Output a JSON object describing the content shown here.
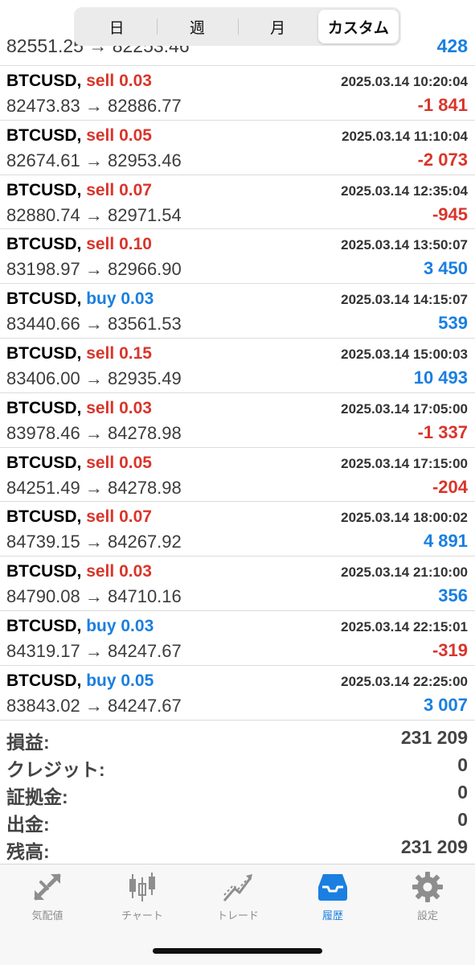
{
  "period_tabs": [
    "日",
    "週",
    "月",
    "カスタム"
  ],
  "partial_row": {
    "prices": "82551.25 → 82253.46",
    "profit": "428"
  },
  "trades": [
    {
      "symbol": "BTCUSD,",
      "type": "sell",
      "volume": "0.03",
      "time": "2025.03.14 10:20:04",
      "open": "82473.83",
      "close": "82886.77",
      "profit": "-1 841"
    },
    {
      "symbol": "BTCUSD,",
      "type": "sell",
      "volume": "0.05",
      "time": "2025.03.14 11:10:04",
      "open": "82674.61",
      "close": "82953.46",
      "profit": "-2 073"
    },
    {
      "symbol": "BTCUSD,",
      "type": "sell",
      "volume": "0.07",
      "time": "2025.03.14 12:35:04",
      "open": "82880.74",
      "close": "82971.54",
      "profit": "-945"
    },
    {
      "symbol": "BTCUSD,",
      "type": "sell",
      "volume": "0.10",
      "time": "2025.03.14 13:50:07",
      "open": "83198.97",
      "close": "82966.90",
      "profit": "3 450"
    },
    {
      "symbol": "BTCUSD,",
      "type": "buy",
      "volume": "0.03",
      "time": "2025.03.14 14:15:07",
      "open": "83440.66",
      "close": "83561.53",
      "profit": "539"
    },
    {
      "symbol": "BTCUSD,",
      "type": "sell",
      "volume": "0.15",
      "time": "2025.03.14 15:00:03",
      "open": "83406.00",
      "close": "82935.49",
      "profit": "10 493"
    },
    {
      "symbol": "BTCUSD,",
      "type": "sell",
      "volume": "0.03",
      "time": "2025.03.14 17:05:00",
      "open": "83978.46",
      "close": "84278.98",
      "profit": "-1 337"
    },
    {
      "symbol": "BTCUSD,",
      "type": "sell",
      "volume": "0.05",
      "time": "2025.03.14 17:15:00",
      "open": "84251.49",
      "close": "84278.98",
      "profit": "-204"
    },
    {
      "symbol": "BTCUSD,",
      "type": "sell",
      "volume": "0.07",
      "time": "2025.03.14 18:00:02",
      "open": "84739.15",
      "close": "84267.92",
      "profit": "4 891"
    },
    {
      "symbol": "BTCUSD,",
      "type": "sell",
      "volume": "0.03",
      "time": "2025.03.14 21:10:00",
      "open": "84790.08",
      "close": "84710.16",
      "profit": "356"
    },
    {
      "symbol": "BTCUSD,",
      "type": "buy",
      "volume": "0.03",
      "time": "2025.03.14 22:15:01",
      "open": "84319.17",
      "close": "84247.67",
      "profit": "-319"
    },
    {
      "symbol": "BTCUSD,",
      "type": "buy",
      "volume": "0.05",
      "time": "2025.03.14 22:25:00",
      "open": "83843.02",
      "close": "84247.67",
      "profit": "3 007"
    }
  ],
  "summary": [
    {
      "label": "損益:",
      "value": "231 209"
    },
    {
      "label": "クレジット:",
      "value": "0"
    },
    {
      "label": "証拠金:",
      "value": "0"
    },
    {
      "label": "出金:",
      "value": "0"
    },
    {
      "label": "残高:",
      "value": "231 209"
    }
  ],
  "tabbar": [
    {
      "label": "気配値",
      "icon": "quotes-arrows-icon",
      "active": false
    },
    {
      "label": "チャート",
      "icon": "candlestick-chart-icon",
      "active": false
    },
    {
      "label": "トレード",
      "icon": "trade-line-icon",
      "active": false
    },
    {
      "label": "履歴",
      "icon": "history-inbox-icon",
      "active": true
    },
    {
      "label": "設定",
      "icon": "gear-icon",
      "active": false
    }
  ],
  "colors": {
    "sell": "#d9352b",
    "buy": "#1a7fe0",
    "negative": "#d9352b",
    "positive": "#1a7fe0",
    "tab_active": "#1a7fe0",
    "tab_inactive": "#8e8e8e"
  }
}
